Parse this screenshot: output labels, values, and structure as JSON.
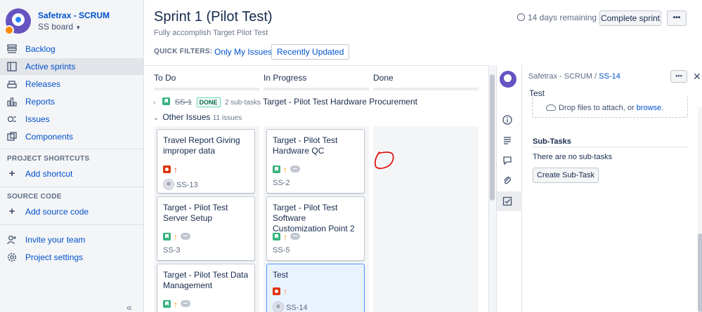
{
  "sidebar": {
    "project_name": "Safetrax - SCRUM",
    "board_name": "SS board",
    "items": [
      {
        "label": "Backlog",
        "icon": "backlog-icon"
      },
      {
        "label": "Active sprints",
        "icon": "board-icon",
        "active": true
      },
      {
        "label": "Releases",
        "icon": "ship-icon"
      },
      {
        "label": "Reports",
        "icon": "chart-icon"
      },
      {
        "label": "Issues",
        "icon": "issues-icon"
      },
      {
        "label": "Components",
        "icon": "component-icon"
      }
    ],
    "project_shortcuts_label": "PROJECT SHORTCUTS",
    "add_shortcut_label": "Add shortcut",
    "source_code_label": "SOURCE CODE",
    "add_source_code_label": "Add source code",
    "invite_label": "Invite your team",
    "settings_label": "Project settings",
    "collapse_glyph": "«"
  },
  "header": {
    "title": "Sprint 1 (Pilot Test)",
    "goal": "Fully accomplish Target Pilot Test",
    "remaining": "14 days remaining",
    "complete_sprint_label": "Complete sprint",
    "more_glyph": "•••",
    "quick_filters_label": "QUICK FILTERS:",
    "filters": [
      "Only My Issues",
      "Recently Updated"
    ]
  },
  "board": {
    "columns": [
      "To Do",
      "In Progress",
      "Done"
    ],
    "parent_row": {
      "key": "SS-1",
      "status": "DONE",
      "subtasks": "2 sub-tasks",
      "summary": "Target - Pilot Test Hardware Procurement"
    },
    "other_issues_label": "Other Issues",
    "other_issues_count": "11 issues",
    "cards": [
      {
        "title": "Travel Report Giving improper data",
        "key": "SS-13",
        "type": "bug",
        "priority": "high",
        "avatar": true
      },
      {
        "title": "Target - Pilot Test Hardware QC",
        "key": "SS-2",
        "type": "story",
        "priority": "medium",
        "estimate": true
      },
      {
        "title": "Target - Pilot Test Server Setup",
        "key": "SS-3",
        "type": "story",
        "priority": "medium",
        "estimate": true
      },
      {
        "title": "Target - Pilot Test Software Customization Point 2",
        "key": "SS-5",
        "type": "story",
        "priority": "medium",
        "estimate": true
      },
      {
        "title": "Target - Pilot Test Data Management",
        "key": "",
        "type": "story",
        "priority": "medium",
        "estimate": true
      },
      {
        "title": "Test",
        "key": "SS-14",
        "type": "bug",
        "priority": "medium",
        "avatar": true,
        "selected": true
      }
    ],
    "annotation_color": "#e00000"
  },
  "detail": {
    "project": "Safetrax - SCRUM",
    "separator": "/",
    "issue_key": "SS-14",
    "summary": "Test",
    "drop_text": "Drop files to attach, or",
    "browse_label": "browse.",
    "subtasks_title": "Sub-Tasks",
    "subtasks_empty": "There are no sub-tasks",
    "create_subtask_label": "Create Sub-Task",
    "more_glyph": "•••",
    "close_glyph": "✕"
  }
}
